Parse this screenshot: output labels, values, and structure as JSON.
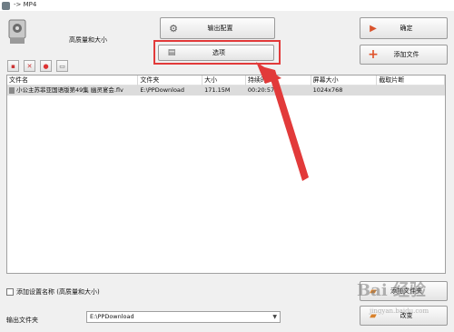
{
  "window": {
    "title": "-> MP4"
  },
  "format": {
    "label": "高质量和大小",
    "icon": "video-format-icon"
  },
  "small_buttons": [
    {
      "icon": "add-file-small-icon"
    },
    {
      "icon": "delete-icon"
    },
    {
      "icon": "play-icon"
    },
    {
      "icon": "settings-box-icon"
    }
  ],
  "buttons": {
    "output_config": "输出配置",
    "options": "选项",
    "ok": "确定",
    "add_file": "添加文件",
    "add_folder": "添加文件夹",
    "change": "改变"
  },
  "table": {
    "columns": [
      "文件名",
      "文件夹",
      "大小",
      "持续时间",
      "屏幕大小",
      "截取片断"
    ],
    "rows": [
      [
        "小公主苏菲亚国语版第49集 幽灵宴会.flv",
        "E:\\PPDownload",
        "171.15M",
        "00:20:57",
        "1024x768",
        ""
      ]
    ]
  },
  "add_setting": {
    "label": "添加设置名称 (高质量和大小)",
    "checked": false
  },
  "output": {
    "label": "输出文件夹",
    "path": "E:\\PPDownload"
  },
  "watermark": {
    "title": "Bai 经验",
    "sub": "jingyan.baidu.com"
  },
  "colors": {
    "highlight": "#e23a3a",
    "selected_row": "#dcdcdc"
  }
}
